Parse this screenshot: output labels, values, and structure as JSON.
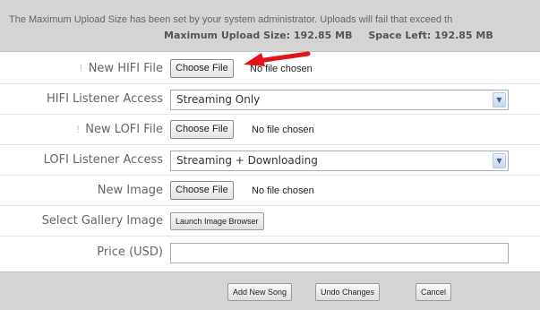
{
  "notice": {
    "line1": "The Maximum Upload Size has been set by your system administrator. Uploads will fail that exceed th",
    "max_label": "Maximum Upload Size:",
    "max_value": "192.85 MB",
    "left_label": "Space Left:",
    "left_value": "192.85 MB"
  },
  "form": {
    "hifi_file": {
      "required_mark": "!",
      "label": "New HIFI File",
      "button": "Choose File",
      "status": "No file chosen"
    },
    "hifi_access": {
      "label": "HIFI Listener Access",
      "value": "Streaming Only"
    },
    "lofi_file": {
      "required_mark": "!",
      "label": "New LOFI File",
      "button": "Choose File",
      "status": "No file chosen"
    },
    "lofi_access": {
      "label": "LOFI Listener Access",
      "value": "Streaming + Downloading"
    },
    "image_file": {
      "label": "New Image",
      "button": "Choose File",
      "status": "No file chosen"
    },
    "gallery": {
      "label": "Select Gallery Image",
      "button": "Launch Image Browser"
    },
    "price": {
      "label": "Price (USD)",
      "value": ""
    }
  },
  "footer": {
    "add_label": "Add New Song",
    "undo_label": "Undo Changes",
    "cancel_label": "Cancel"
  },
  "icons": {
    "select_arrow": "chevron-down-icon",
    "annotation": "red-arrow-icon"
  },
  "colors": {
    "annotation_arrow": "#e3131b",
    "panel_bg": "#d4d4d4"
  }
}
